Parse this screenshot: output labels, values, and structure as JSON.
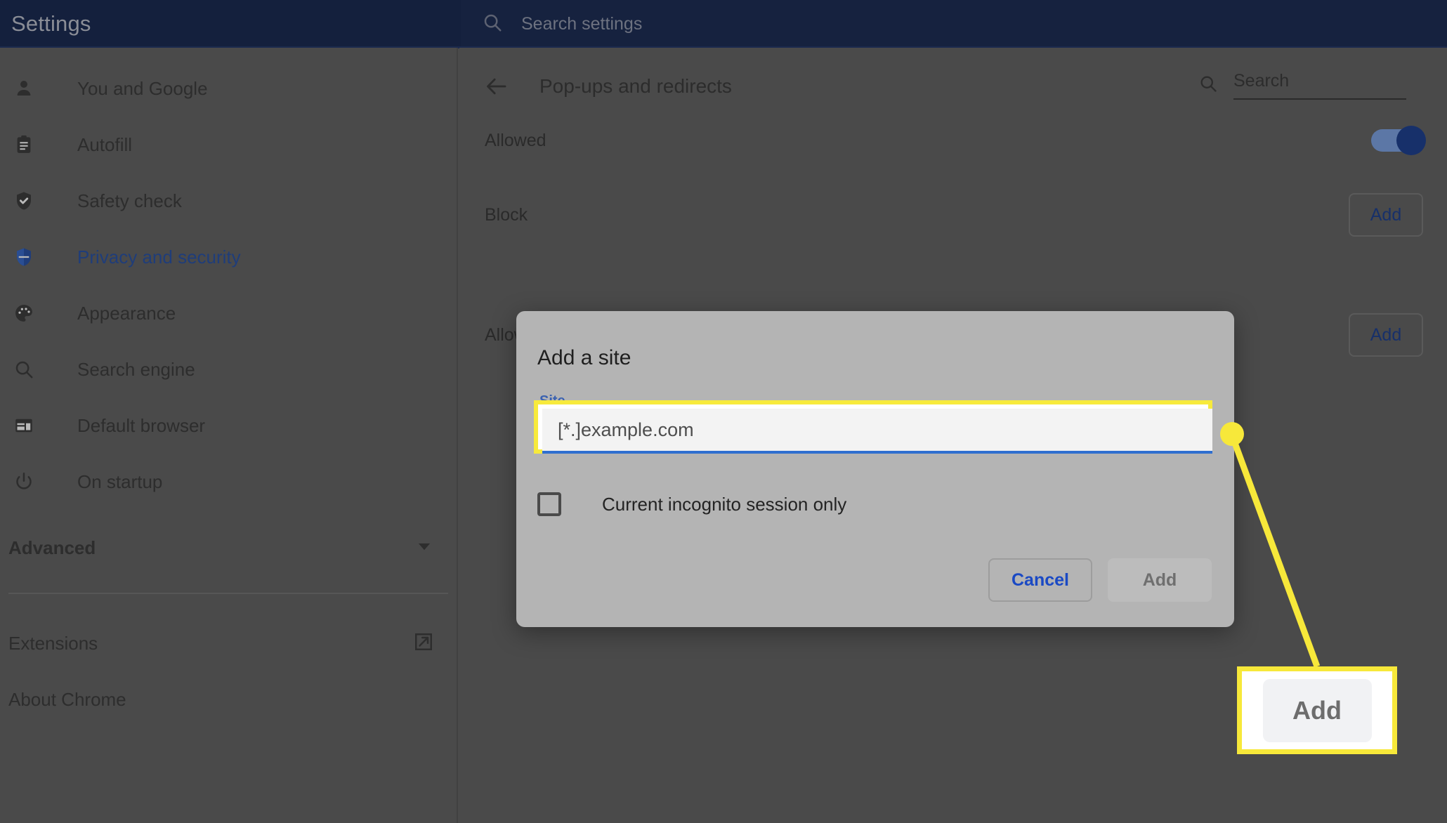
{
  "header": {
    "title": "Settings",
    "search_placeholder": "Search settings",
    "search_icon": "search-icon"
  },
  "sidebar": {
    "items": [
      {
        "label": "You and Google",
        "icon": "person-icon",
        "active": false
      },
      {
        "label": "Autofill",
        "icon": "clipboard-icon",
        "active": false
      },
      {
        "label": "Safety check",
        "icon": "shield-check-icon",
        "active": false
      },
      {
        "label": "Privacy and security",
        "icon": "shield-icon",
        "active": true
      },
      {
        "label": "Appearance",
        "icon": "palette-icon",
        "active": false
      },
      {
        "label": "Search engine",
        "icon": "search-icon",
        "active": false
      },
      {
        "label": "Default browser",
        "icon": "browser-window-icon",
        "active": false
      },
      {
        "label": "On startup",
        "icon": "power-icon",
        "active": false
      }
    ],
    "advanced": {
      "label": "Advanced",
      "icon": "chevron-down-icon"
    },
    "footer_items": [
      {
        "label": "Extensions",
        "icon": "external-link-icon"
      },
      {
        "label": "About Chrome",
        "icon": ""
      }
    ]
  },
  "main": {
    "back_icon": "arrow-left-icon",
    "page_title": "Pop-ups and redirects",
    "search_icon": "search-icon",
    "search_placeholder": "Search",
    "sections": [
      {
        "label": "Allowed",
        "control": "toggle",
        "toggle_on": true
      },
      {
        "label": "Block",
        "control": "button",
        "button_label": "Add"
      },
      {
        "label": "Allowed to send pop-ups and use redirects",
        "control": "button",
        "button_label": "Add"
      }
    ]
  },
  "dialog": {
    "title": "Add a site",
    "field_label": "Site",
    "input_value": "[*.]example.com",
    "checkbox_label": "Current incognito session only",
    "checkbox_checked": false,
    "cancel_label": "Cancel",
    "add_label": "Add"
  },
  "annotation": {
    "callout_button_label": "Add",
    "highlight_color": "#f7e83a",
    "dot_color": "#f7e83a"
  },
  "colors": {
    "header_bg": "#14203d",
    "page_bg": "#4a4a4a",
    "dialog_bg": "#b4b4b4",
    "accent_blue": "#1a49c4",
    "link_blue": "#17306a",
    "focus_underline": "#2f6fd0"
  }
}
